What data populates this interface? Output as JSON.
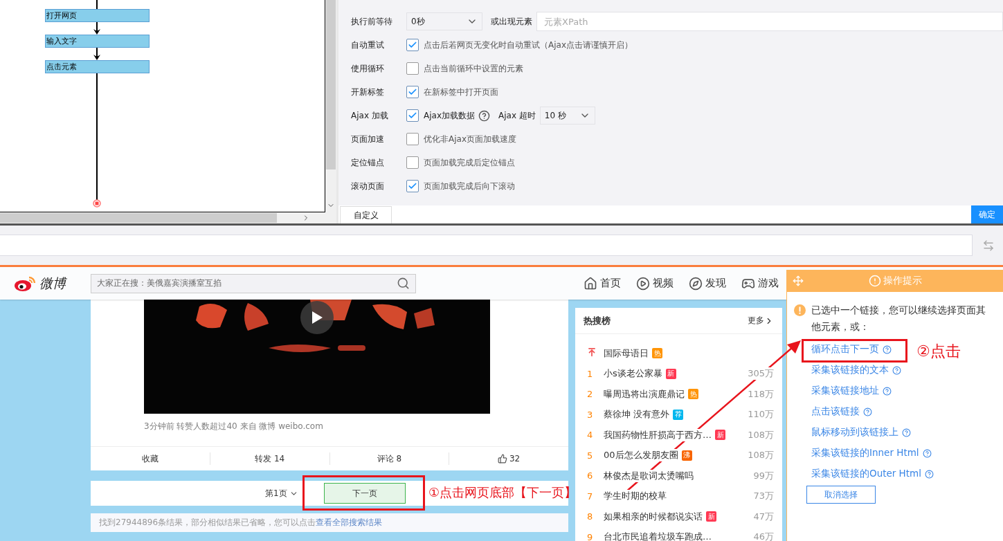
{
  "flowchart": {
    "nodes": [
      {
        "label": "打开网页"
      },
      {
        "label": "输入文字"
      },
      {
        "label": "点击元素"
      }
    ]
  },
  "settings": {
    "rows": [
      {
        "kind": "wait",
        "label": "执行前等待",
        "select": "0秒",
        "extra_label": "或出现元素",
        "placeholder": "元素XPath"
      },
      {
        "kind": "checkbox",
        "label": "自动重试",
        "checked": true,
        "text": "点击后若网页无变化时自动重试（Ajax点击请谨慎开启）"
      },
      {
        "kind": "checkbox",
        "label": "使用循环",
        "checked": false,
        "text": "点击当前循环中设置的元素"
      },
      {
        "kind": "checkbox",
        "label": "开新标签",
        "checked": true,
        "text": "在新标签中打开页面"
      },
      {
        "kind": "ajax",
        "label": "Ajax 加载",
        "checked": true,
        "text": "Ajax加载数据",
        "extra_label": "Ajax 超时",
        "select": "10 秒"
      },
      {
        "kind": "checkbox",
        "label": "页面加速",
        "checked": false,
        "text": "优化非Ajax页面加载速度"
      },
      {
        "kind": "checkbox",
        "label": "定位锚点",
        "checked": false,
        "text": "页面加载完成后定位锚点"
      },
      {
        "kind": "checkbox",
        "label": "滚动页面",
        "checked": true,
        "text": "页面加载完成后向下滚动"
      }
    ],
    "tab": "自定义",
    "confirm": "确定"
  },
  "weibo": {
    "logo": "微博",
    "search_placeholder": "大家正在搜：美俄嘉宾演播室互掐",
    "nav": [
      {
        "kind": "home",
        "label": "首页"
      },
      {
        "kind": "video",
        "label": "视频"
      },
      {
        "kind": "discover",
        "label": "发现"
      },
      {
        "kind": "game",
        "label": "游戏"
      }
    ],
    "post": {
      "meta": "3分钟前 转赞人数超过40 来自 微博 weibo.com",
      "actions": [
        {
          "kind": "text",
          "label": "收藏"
        },
        {
          "kind": "text",
          "label": "转发 14"
        },
        {
          "kind": "text",
          "label": "评论 8"
        },
        {
          "kind": "like",
          "label": "32"
        }
      ]
    },
    "pager": {
      "page": "第1页",
      "next": "下一页"
    },
    "result_note": {
      "text": "找到27944896条结果，部分相似结果已省略，您可以点击",
      "link": "查看全部搜索结果"
    },
    "hot": {
      "title": "热搜榜",
      "more": "更多",
      "items": [
        {
          "kind": "pinned",
          "title": "国际母语日",
          "badge": "热",
          "color": "#ff9406"
        },
        {
          "kind": "ranked",
          "rank": "1",
          "title": "小s谈老公家暴",
          "badge": "新",
          "color": "#ff3852",
          "count": "305万"
        },
        {
          "kind": "ranked",
          "rank": "2",
          "title": "曝周迅将出演鹿鼎记",
          "badge": "热",
          "color": "#ff9406",
          "count": "118万"
        },
        {
          "kind": "ranked",
          "rank": "3",
          "title": "蔡徐坤 没有意外",
          "badge": "荐",
          "color": "#00b7ee",
          "count": "110万"
        },
        {
          "kind": "ranked",
          "rank": "4",
          "title": "我国药物性肝损高于西方…",
          "badge": "新",
          "color": "#ff3852",
          "count": "108万"
        },
        {
          "kind": "ranked",
          "rank": "5",
          "title": "00后怎么发朋友圈",
          "badge": "沸",
          "color": "#f86400",
          "count": "108万"
        },
        {
          "kind": "ranked",
          "rank": "6",
          "title": "林俊杰是歌词太烫嘴吗",
          "count": "99万"
        },
        {
          "kind": "ranked",
          "rank": "7",
          "title": "学生时期的校草",
          "count": "73万"
        },
        {
          "kind": "ranked",
          "rank": "8",
          "title": "如果相亲的时候都说实话",
          "badge": "新",
          "color": "#ff3852",
          "count": "47万"
        },
        {
          "kind": "ranked",
          "rank": "9",
          "title": "台北市民追着垃圾车跑成…",
          "count": "46万"
        }
      ]
    }
  },
  "hint_panel": {
    "title": "操作提示",
    "message": "已选中一个链接，您可以继续选择页面其他元素，或：",
    "actions": [
      {
        "label": "循环点击下一页"
      },
      {
        "label": "采集该链接的文本"
      },
      {
        "label": "采集该链接地址"
      },
      {
        "label": "点击该链接"
      },
      {
        "label": "鼠标移动到该链接上"
      },
      {
        "label": "采集该链接的Inner Html"
      },
      {
        "label": "采集该链接的Outer Html"
      }
    ],
    "cancel": "取消选择"
  },
  "annotations": [
    {
      "text": "①点击网页底部【下一页】"
    },
    {
      "text": "②点击"
    }
  ]
}
